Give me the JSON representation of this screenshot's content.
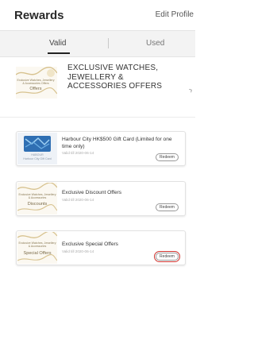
{
  "header": {
    "title": "Rewards",
    "edit_label": "Edit Profile"
  },
  "tabs": [
    {
      "label": "Valid",
      "active": true
    },
    {
      "label": "Used",
      "active": false
    }
  ],
  "banner": {
    "thumb_text": "Exclusive Watches, Jewellery & Accessories Offers",
    "thumb_big": "Offers",
    "title": "EXCLUSIVE WATCHES, JEWELLERY & ACCESSORIES OFFERS"
  },
  "cards": [
    {
      "thumb_caption_1": "HABOUR",
      "thumb_caption_2": "Harbour City Gift Card",
      "title": "Harbour City HK$500 Gift Card (Limited for one time only)",
      "date": "Valid till 2020-06-14",
      "redeem_label": "Redeem"
    },
    {
      "thumb_text": "Exclusive Watches, Jewellery & Accessories",
      "thumb_big": "Discounts",
      "title": "Exclusive Discount Offers",
      "date": "Valid till 2020-06-14",
      "redeem_label": "Redeem"
    },
    {
      "thumb_text": "Exclusive Watches, Jewellery & Accessories",
      "thumb_big": "Special Offers",
      "title": "Exclusive Special Offers",
      "date": "Valid till 2020-06-14",
      "redeem_label": "Redeem"
    }
  ],
  "colors": {
    "highlight": "#d0332e",
    "gold": "#c9b27a",
    "card_blue": "#2f6fb3"
  }
}
